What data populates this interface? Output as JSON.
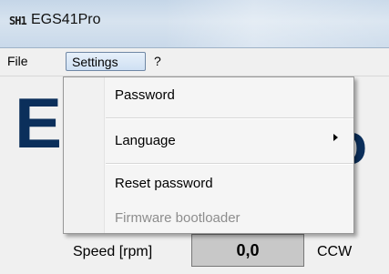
{
  "window": {
    "icon_text": "SH1",
    "title": "EGS41Pro"
  },
  "menubar": {
    "file": "File",
    "settings": "Settings",
    "help": "?"
  },
  "settings_menu": {
    "items": [
      {
        "label": "Password",
        "enabled": true
      },
      {
        "label": "Language",
        "enabled": true,
        "has_submenu": true
      },
      {
        "label": "Reset password",
        "enabled": true
      },
      {
        "label": "Firmware bootloader",
        "enabled": false
      }
    ]
  },
  "main": {
    "brand_left": "E",
    "brand_right": "o",
    "speed_label": "Speed [rpm]",
    "speed_value": "0,0",
    "direction": "CCW"
  },
  "colors": {
    "brand": "#0b2f5b",
    "menu_highlight": "#cfe0f3"
  }
}
